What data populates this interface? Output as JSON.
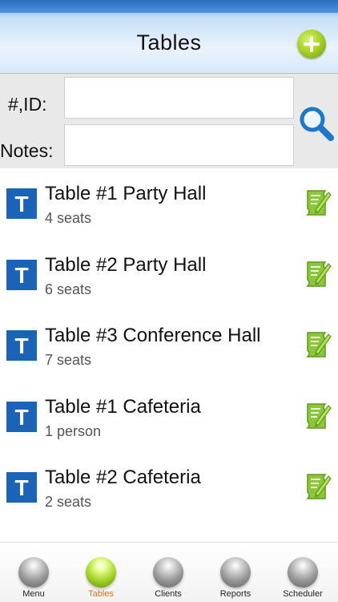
{
  "header": {
    "title": "Tables",
    "add_icon": "plus-circle-icon"
  },
  "search": {
    "id_label": "#,ID:",
    "id_value": "",
    "notes_label": "Notes:",
    "notes_value": "",
    "search_icon": "magnifier-icon"
  },
  "tables": [
    {
      "icon_letter": "T",
      "title": "Table #1 Party Hall",
      "subtitle": "4 seats"
    },
    {
      "icon_letter": "T",
      "title": "Table #2 Party Hall",
      "subtitle": "6 seats"
    },
    {
      "icon_letter": "T",
      "title": "Table #3 Conference Hall",
      "subtitle": "7 seats"
    },
    {
      "icon_letter": "T",
      "title": "Table #1 Cafeteria",
      "subtitle": "1 person"
    },
    {
      "icon_letter": "T",
      "title": "Table #2 Cafeteria",
      "subtitle": "2 seats"
    }
  ],
  "tabbar": {
    "items": [
      {
        "label": "Menu",
        "active": false
      },
      {
        "label": "Tables",
        "active": true
      },
      {
        "label": "Clients",
        "active": false
      },
      {
        "label": "Reports",
        "active": false
      },
      {
        "label": "Scheduler",
        "active": false
      }
    ],
    "active_color": "#d4761c"
  },
  "colors": {
    "accent": "#1b63b7",
    "add_button": "#a7d428",
    "edit_icon": "#8cc63f"
  }
}
